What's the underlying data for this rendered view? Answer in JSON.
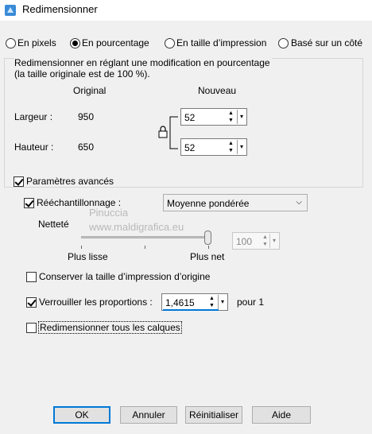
{
  "window": {
    "title": "Redimensionner"
  },
  "modes": [
    {
      "label": "En pixels",
      "selected": false
    },
    {
      "label": "En pourcentage",
      "selected": true
    },
    {
      "label": "En taille d’impression",
      "selected": false
    },
    {
      "label": "Basé sur un côté",
      "selected": false
    }
  ],
  "description": {
    "line1": "Redimensionner en réglant une modification en pourcentage",
    "line2": "(la taille originale est de 100 %)."
  },
  "dimensions": {
    "original_header": "Original",
    "new_header": "Nouveau",
    "width_label": "Largeur :",
    "width_original": "950",
    "width_new": "52",
    "height_label": "Hauteur :",
    "height_original": "650",
    "height_new": "52"
  },
  "advanced": {
    "label": "Paramètres avancés",
    "checked": true,
    "resample_label": "Rééchantillonnage :",
    "resample_checked": true,
    "resample_method": "Moyenne pondérée",
    "sharpness_label": "Netteté",
    "slider_min_label": "Plus lisse",
    "slider_max_label": "Plus net",
    "sharpness_value": "100",
    "sharpness_level": 1.0
  },
  "options": {
    "keep_print_size": {
      "label": "Conserver la taille d’impression d’origine",
      "checked": false
    },
    "lock_ratio": {
      "label": "Verrouiller les proportions :",
      "checked": true,
      "value": "1,4615",
      "suffix": "pour 1"
    },
    "resize_all_layers": {
      "label": "Redimensionner tous les calques",
      "checked": false
    }
  },
  "buttons": {
    "ok": "OK",
    "cancel": "Annuler",
    "reset": "Réinitialiser",
    "help": "Aide"
  },
  "watermark": {
    "line1": "Pinuccia",
    "line2": "www.maldigrafica.eu"
  },
  "colors": {
    "accent": "#0078d7",
    "dialog_bg": "#f0f0f0"
  }
}
